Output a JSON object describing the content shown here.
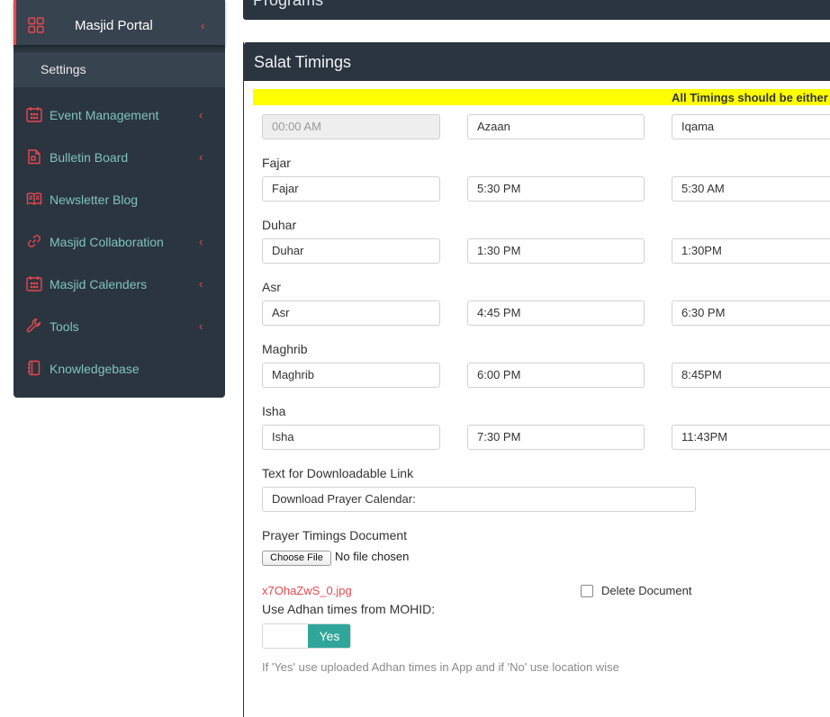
{
  "sidebar": {
    "active": {
      "label": "Masjid Portal",
      "icon": "grid-icon"
    },
    "sub_item": {
      "label": "Settings"
    },
    "items": [
      {
        "label": "Event Management",
        "icon": "calendar-icon",
        "has_chevron": true
      },
      {
        "label": "Bulletin Board",
        "icon": "document-icon",
        "has_chevron": true
      },
      {
        "label": "Newsletter Blog",
        "icon": "book-icon",
        "has_chevron": false
      },
      {
        "label": "Masjid Collaboration",
        "icon": "link-icon",
        "has_chevron": true
      },
      {
        "label": "Masjid Calenders",
        "icon": "calendar-icon",
        "has_chevron": true
      },
      {
        "label": "Tools",
        "icon": "wrench-icon",
        "has_chevron": true
      },
      {
        "label": "Knowledgebase",
        "icon": "notebook-icon",
        "has_chevron": false
      }
    ],
    "chevron_glyph": "‹"
  },
  "programs_panel": {
    "title": "Programs"
  },
  "salat_panel": {
    "title": "Salat Timings",
    "banner": "All Timings should be either",
    "header_row": {
      "time": "00:00 AM",
      "azaan": "Azaan",
      "iqama": "Iqama"
    },
    "prayers": [
      {
        "label": "Fajar",
        "name": "Fajar",
        "azaan": "5:30 PM",
        "iqama": "5:30 AM"
      },
      {
        "label": "Duhar",
        "name": "Duhar",
        "azaan": "1:30 PM",
        "iqama": "1:30PM"
      },
      {
        "label": "Asr",
        "name": "Asr",
        "azaan": "4:45 PM",
        "iqama": "6:30 PM"
      },
      {
        "label": "Maghrib",
        "name": "Maghrib",
        "azaan": "6:00 PM",
        "iqama": "8:45PM"
      },
      {
        "label": "Isha",
        "name": "Isha",
        "azaan": "7:30 PM",
        "iqama": "11:43PM"
      }
    ],
    "download_link_label": "Text for Downloadable Link",
    "download_link_value": "Download Prayer Calendar:",
    "document_label": "Prayer Timings Document",
    "choose_file": "Choose File",
    "no_file": "No file chosen",
    "file_name": "x7OhaZwS_0.jpg",
    "delete_document": "Delete Document",
    "adhan_label": "Use Adhan times from MOHID:",
    "toggle_value": "Yes",
    "hint": "If 'Yes' use uploaded Adhan times in App and if 'No' use location wise"
  },
  "colors": {
    "sidebar_bg": "#2b3540",
    "accent_red": "#e8474f",
    "menu_teal": "#7fc4b8",
    "toggle_on": "#2fa699",
    "banner_yellow": "#ffff00"
  }
}
